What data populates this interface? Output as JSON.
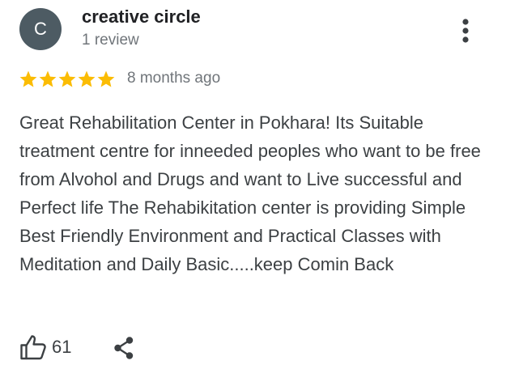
{
  "reviewer": {
    "avatar_letter": "C",
    "avatar_color": "#4d5b63",
    "name": "creative circle",
    "review_count": "1 review"
  },
  "menu": {
    "icon": "more-vert-icon"
  },
  "rating": {
    "stars": 5,
    "max_stars": 5,
    "star_color": "#fbbc04",
    "date": "8 months ago"
  },
  "review": {
    "text": "Great Rehabilitation Center in Pokhara! Its Suitable treatment centre for inneeded peoples who want to be free from Alvohol and Drugs and want to Live successful and Perfect life The Rehabikitation center is providing Simple Best Friendly Environment and Practical Classes with Meditation and Daily Basic.....keep Comin Back"
  },
  "actions": {
    "like_icon": "thumbs-up-icon",
    "like_count": "61",
    "share_icon": "share-icon"
  }
}
